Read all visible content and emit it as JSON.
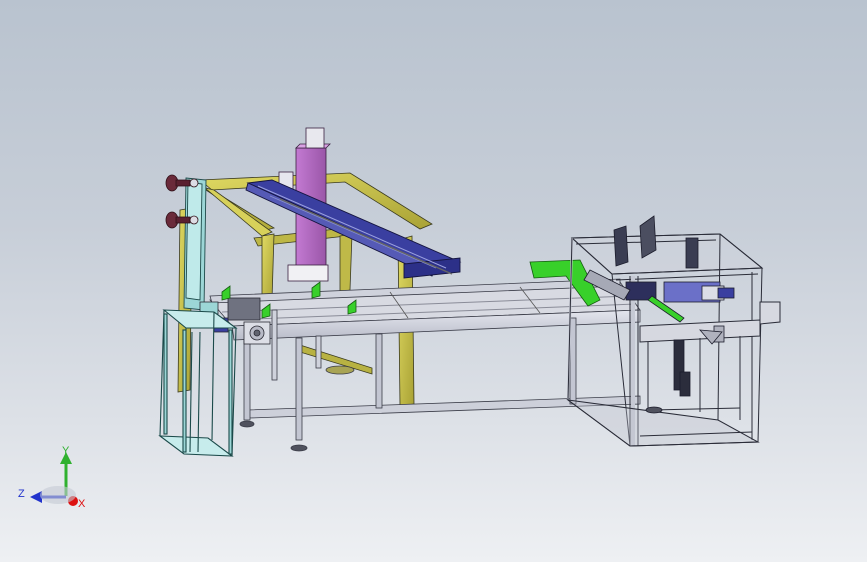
{
  "triad": {
    "y_label": "Y",
    "z_label": "Z",
    "x_label": "X",
    "y_color": "#2fb12f",
    "z_color": "#2233cc",
    "x_color": "#dd1111"
  },
  "palette": {
    "frame": "#c8cad6",
    "frame_edge": "#3a3c48",
    "yellow_frame": "#c9c34a",
    "blue_beam": "#3a3fa0",
    "magenta_column": "#b26ac0",
    "cyan_panel": "#9cd6d6",
    "green_guide": "#38d02a"
  }
}
